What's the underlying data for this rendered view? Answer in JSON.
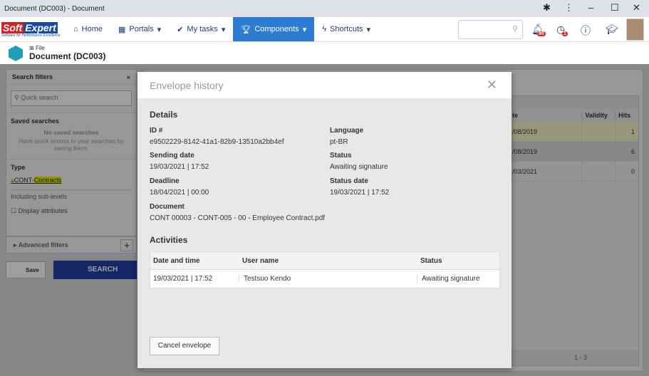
{
  "window": {
    "title": "Document (DC003) - Document"
  },
  "nav": {
    "logo_text_1": "Soft",
    "logo_text_2": "Expert",
    "logo_tagline": "Software for Performance Excellence",
    "items": [
      {
        "label": "Home",
        "icon": "home-icon"
      },
      {
        "label": "Portals",
        "icon": "grid-icon"
      },
      {
        "label": "My tasks",
        "icon": "check-icon"
      },
      {
        "label": "Components",
        "icon": "trophy-icon"
      },
      {
        "label": "Shortcuts",
        "icon": "bolt-icon"
      }
    ],
    "notifications_count": "90",
    "alerts_count": "1"
  },
  "page": {
    "breadcrumb": "File",
    "title": "Document (DC003)"
  },
  "sidebar": {
    "title": "Search filters",
    "quick_search_placeholder": "Quick search",
    "saved_searches": "Saved searches",
    "no_saved": "No saved searches",
    "no_saved_hint": "Have quick access to your searches by saving them.",
    "type_label": "Type",
    "type_prefix": "CONT-",
    "type_name": "Contracts",
    "sub_levels": "Including sub-levels",
    "display_attributes": "Display attributes",
    "advanced_filters": "Advanced filters",
    "save": "Save",
    "search": "SEARCH"
  },
  "table": {
    "headers": [
      "te",
      "Validity",
      "Hits"
    ],
    "rows": [
      [
        "/08/2019",
        "",
        "1"
      ],
      [
        "/08/2019",
        "",
        "6"
      ],
      [
        "/03/2021",
        "",
        "0"
      ]
    ],
    "pager": "1 - 3"
  },
  "modal": {
    "title": "Envelope history",
    "details_heading": "Details",
    "fields": {
      "id_label": "ID #",
      "id": "e9502229-8142-41a1-82b9-13510a2bb4ef",
      "language_label": "Language",
      "language": "pt-BR",
      "sending_label": "Sending date",
      "sending": "19/03/2021 | 17:52",
      "status_label": "Status",
      "status": "Awaiting signature",
      "deadline_label": "Deadline",
      "deadline": "18/04/2021 | 00:00",
      "status_date_label": "Status date",
      "status_date": "19/03/2021 | 17:52",
      "document_label": "Document",
      "document": "CONT 00003 - CONT-005 - 00 - Employee Contract.pdf"
    },
    "activities_heading": "Activities",
    "activity_headers": [
      "Date and time",
      "User name",
      "Status"
    ],
    "activities": [
      [
        "19/03/2021 | 17:52",
        "Testsuo Kendo",
        "Awaiting signature"
      ]
    ],
    "cancel": "Cancel envelope"
  }
}
